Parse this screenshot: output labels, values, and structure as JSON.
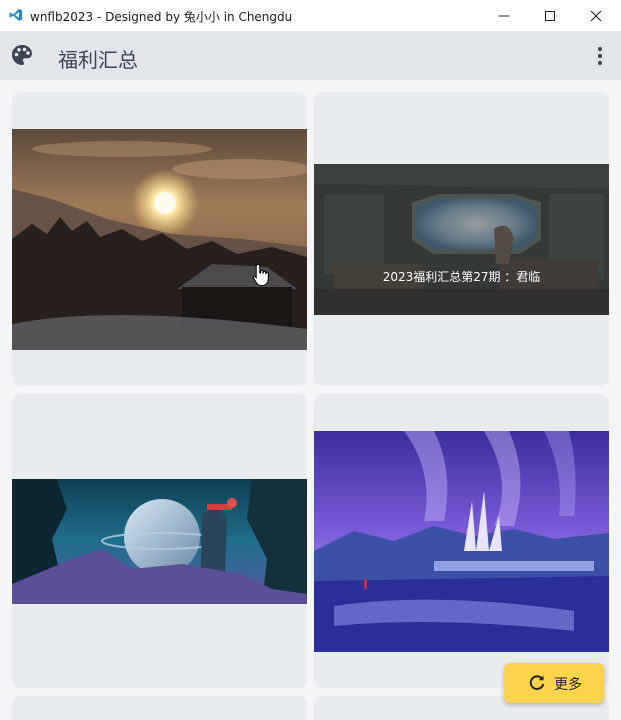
{
  "window": {
    "title": "wnflb2023 - Designed by 兔小小 in Chengdu",
    "icon": "vscode-icon",
    "controls": [
      "minimize-icon",
      "maximize-icon",
      "close-icon"
    ]
  },
  "appbar": {
    "icon": "palette-icon",
    "title": "福利汇总",
    "menu_icon": "more-vert-icon"
  },
  "cards": [
    {
      "image": "sunset-snow-forest-cabin",
      "caption": ""
    },
    {
      "image": "spaceship-cockpit-earth",
      "caption": "2023福利汇总第27期 ：君临"
    },
    {
      "image": "alien-planet-cliffs",
      "caption": ""
    },
    {
      "image": "aurora-crystal-castle",
      "caption": ""
    }
  ],
  "more_button": {
    "icon": "refresh-icon",
    "label": "更多"
  },
  "colors": {
    "appbar_bg": "#e2e5ea",
    "card_bg": "#e9ecef",
    "accent_button": "#fcd34d",
    "heading_text": "#3e4552"
  }
}
